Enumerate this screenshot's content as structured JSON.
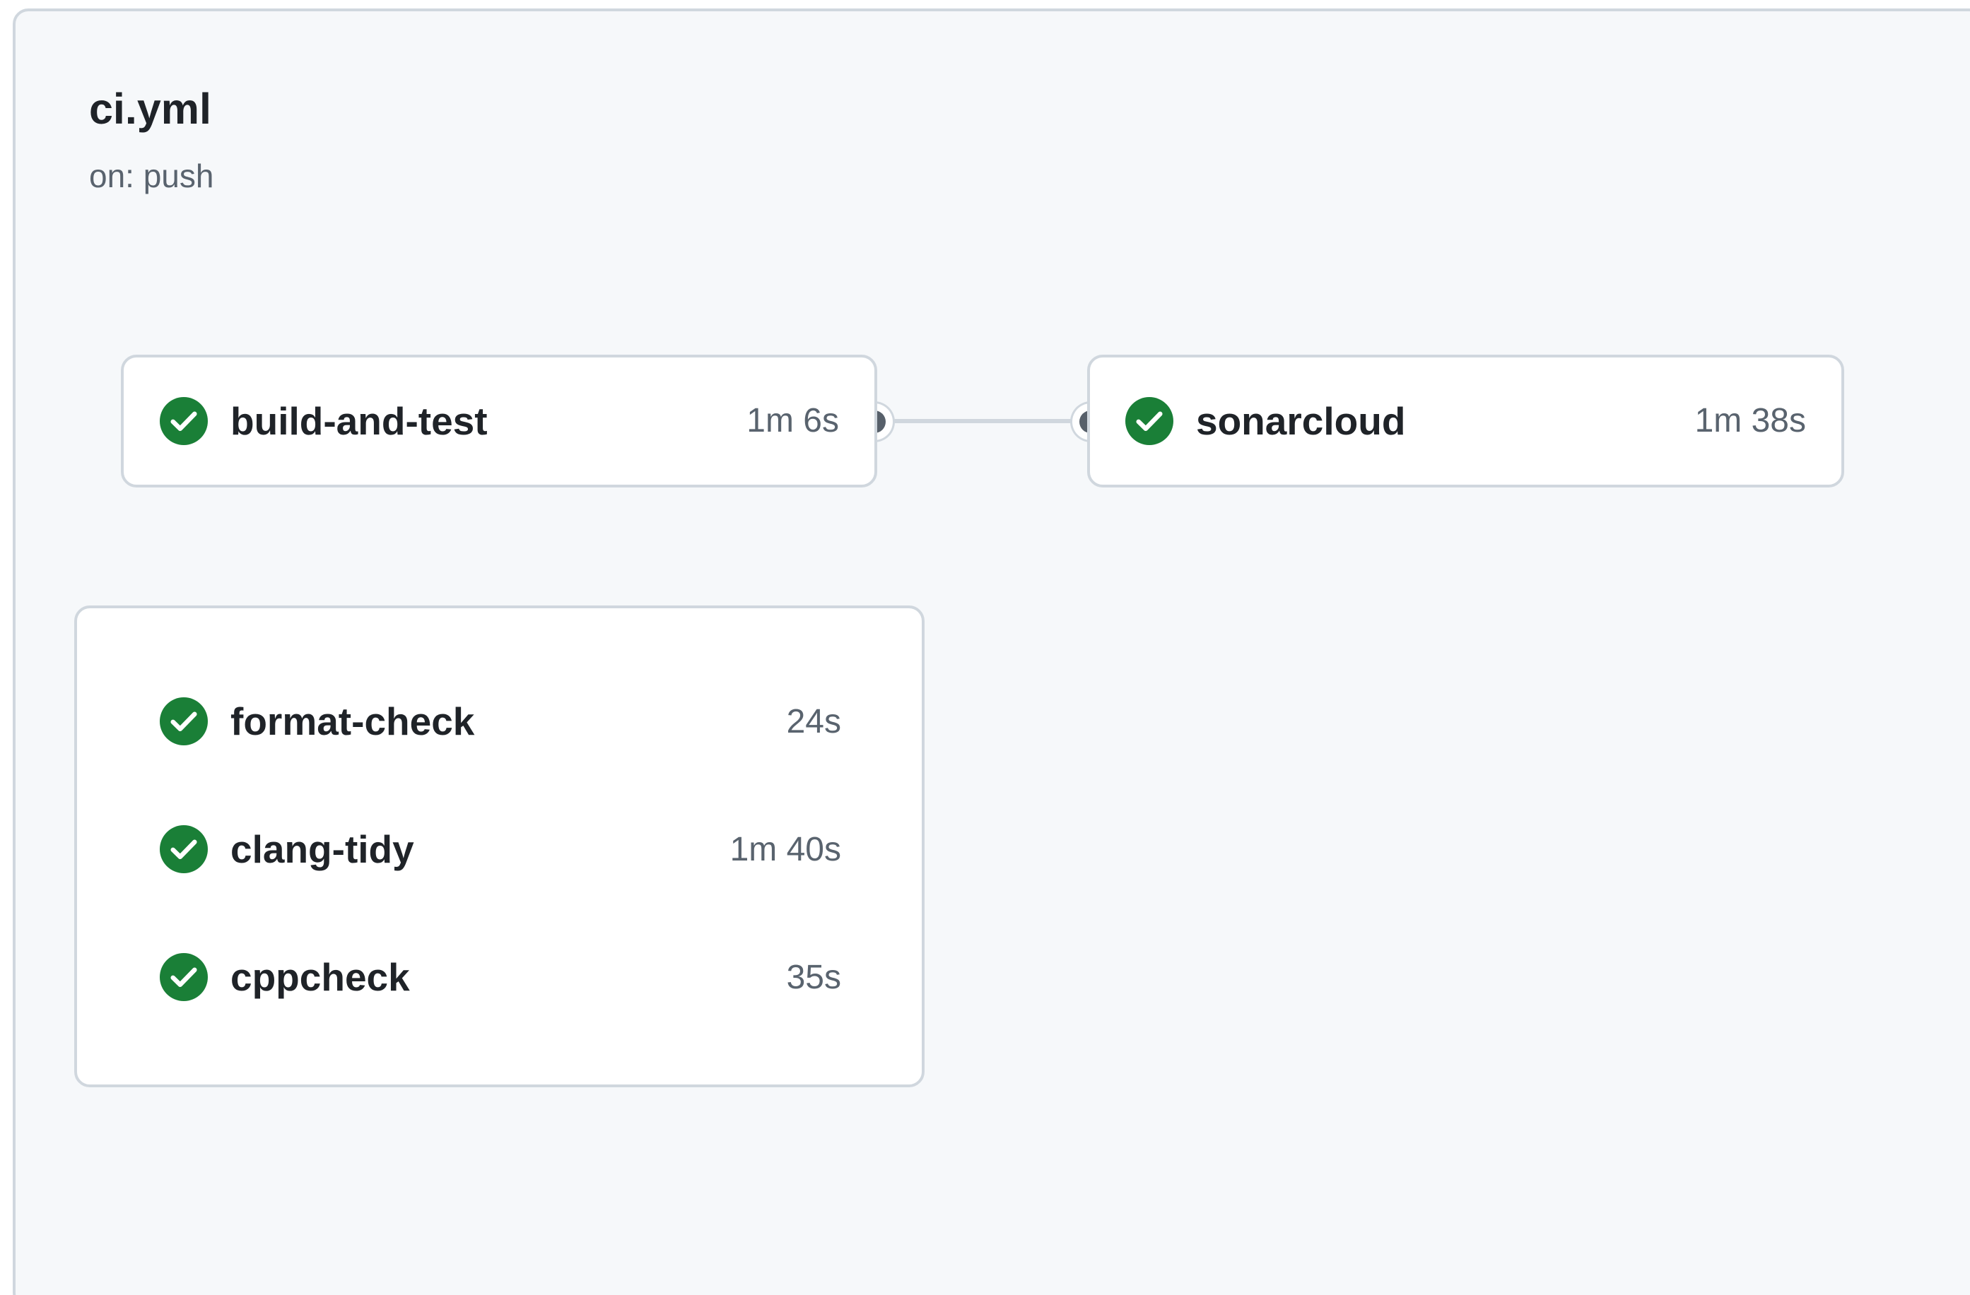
{
  "workflow": {
    "title": "ci.yml",
    "trigger": "on: push"
  },
  "colors": {
    "success": "#1a7f37",
    "panel_background": "#f6f8fa",
    "border": "#d0d7de",
    "text_primary": "#1f2328",
    "text_muted": "#59636e",
    "node": "#57606a"
  },
  "status_icon": "check-circle-fill-icon",
  "jobs": {
    "build": {
      "name": "build-and-test",
      "duration": "1m 6s",
      "status": "success"
    },
    "sonar": {
      "name": "sonarcloud",
      "duration": "1m 38s",
      "status": "success"
    },
    "group": [
      {
        "name": "format-check",
        "duration": "24s",
        "status": "success"
      },
      {
        "name": "clang-tidy",
        "duration": "1m 40s",
        "status": "success"
      },
      {
        "name": "cppcheck",
        "duration": "35s",
        "status": "success"
      }
    ]
  },
  "dependencies": [
    {
      "from": "build-and-test",
      "to": "sonarcloud"
    }
  ]
}
